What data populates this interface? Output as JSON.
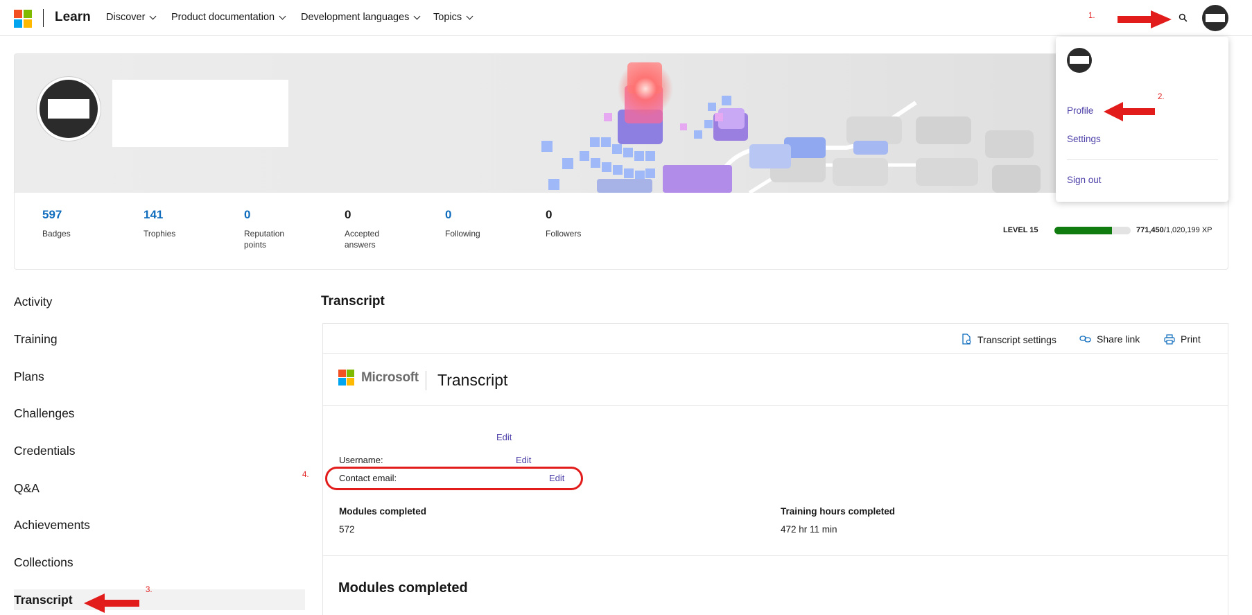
{
  "header": {
    "brand": "Learn",
    "nav": [
      "Discover",
      "Product documentation",
      "Development languages",
      "Topics"
    ]
  },
  "annotations": [
    "1.",
    "2.",
    "3.",
    "4."
  ],
  "profile": {
    "stats": [
      {
        "value": "597",
        "label": "Badges",
        "accent": true
      },
      {
        "value": "141",
        "label": "Trophies",
        "accent": true
      },
      {
        "value": "0",
        "label": "Reputation points",
        "accent": true
      },
      {
        "value": "0",
        "label": "Accepted answers",
        "accent": false
      },
      {
        "value": "0",
        "label": "Following",
        "accent": true
      },
      {
        "value": "0",
        "label": "Followers",
        "accent": false
      }
    ],
    "level_label": "LEVEL 15",
    "xp_current": "771,450",
    "xp_total": "/1,020,199 XP",
    "xp_fraction": 0.756
  },
  "dropdown": {
    "items": [
      "Profile",
      "Settings",
      "Sign out"
    ]
  },
  "sidenav": {
    "items": [
      "Activity",
      "Training",
      "Plans",
      "Challenges",
      "Credentials",
      "Q&A",
      "Achievements",
      "Collections",
      "Transcript"
    ],
    "active": "Transcript"
  },
  "transcript": {
    "title": "Transcript",
    "toolbar": {
      "settings": "Transcript settings",
      "share": "Share link",
      "print": "Print"
    },
    "ms_word": "Microsoft",
    "heading": "Transcript",
    "edit_label": "Edit",
    "username_label": "Username:",
    "email_label": "Contact email:",
    "modules_label": "Modules completed",
    "modules_value": "572",
    "hours_label": "Training hours completed",
    "hours_value": "472 hr 11 min",
    "section_heading": "Modules completed"
  },
  "colors": {
    "accent": "#0f6cbd",
    "link": "#4b3fa8",
    "xp": "#107c10",
    "annotation": "#e21b1b"
  }
}
